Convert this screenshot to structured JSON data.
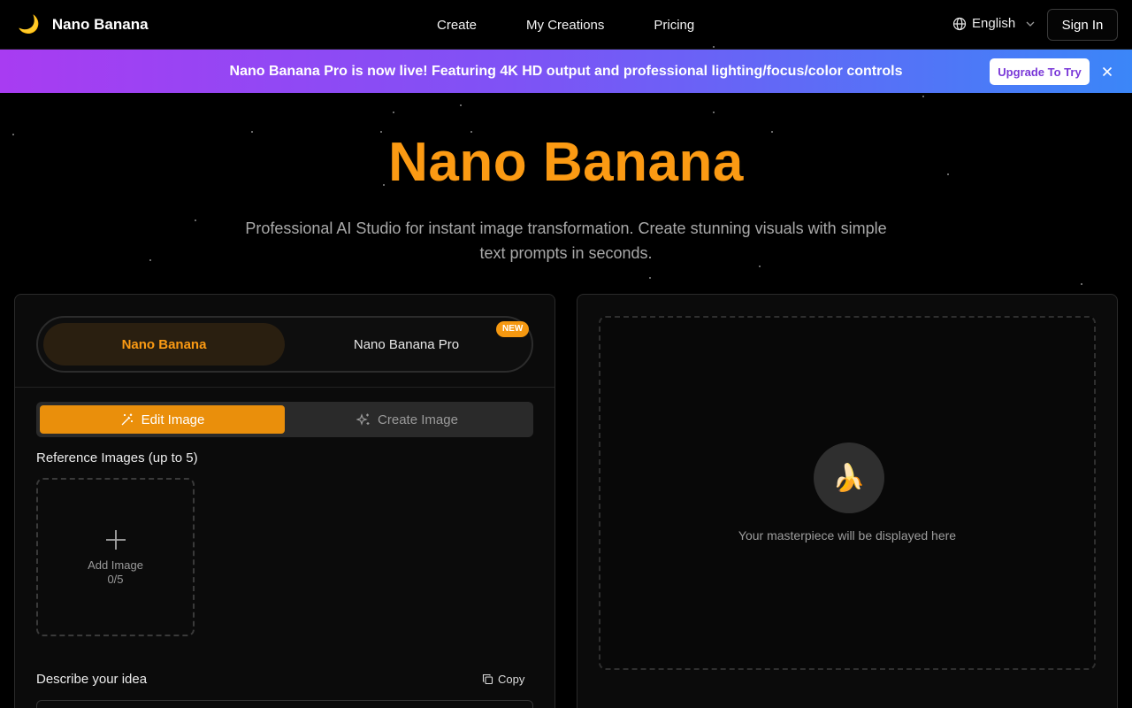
{
  "header": {
    "brand_icon": "🌙",
    "brand_name": "Nano Banana",
    "nav": [
      "Create",
      "My Creations",
      "Pricing"
    ],
    "language": "English",
    "signin": "Sign In"
  },
  "banner": {
    "text": "Nano Banana Pro is now live! Featuring 4K HD output and professional lighting/focus/color controls",
    "button": "Upgrade To Try"
  },
  "hero": {
    "title": "Nano Banana",
    "subtitle": "Professional AI Studio for instant image transformation. Create stunning visuals with simple text prompts in seconds."
  },
  "left_panel": {
    "models": [
      "Nano Banana",
      "Nano Banana Pro"
    ],
    "new_badge": "NEW",
    "tabs": [
      "Edit Image",
      "Create Image"
    ],
    "reference_label": "Reference Images (up to 5)",
    "add_image": "Add Image",
    "add_count": "0/5",
    "describe_label": "Describe your idea",
    "copy_label": "Copy"
  },
  "right_panel": {
    "placeholder_icon": "🍌",
    "placeholder_text": "Your masterpiece will be displayed here"
  },
  "colors": {
    "accent": "#fb9a13",
    "banner_start": "#a83cf2",
    "banner_end": "#3b86f8"
  }
}
